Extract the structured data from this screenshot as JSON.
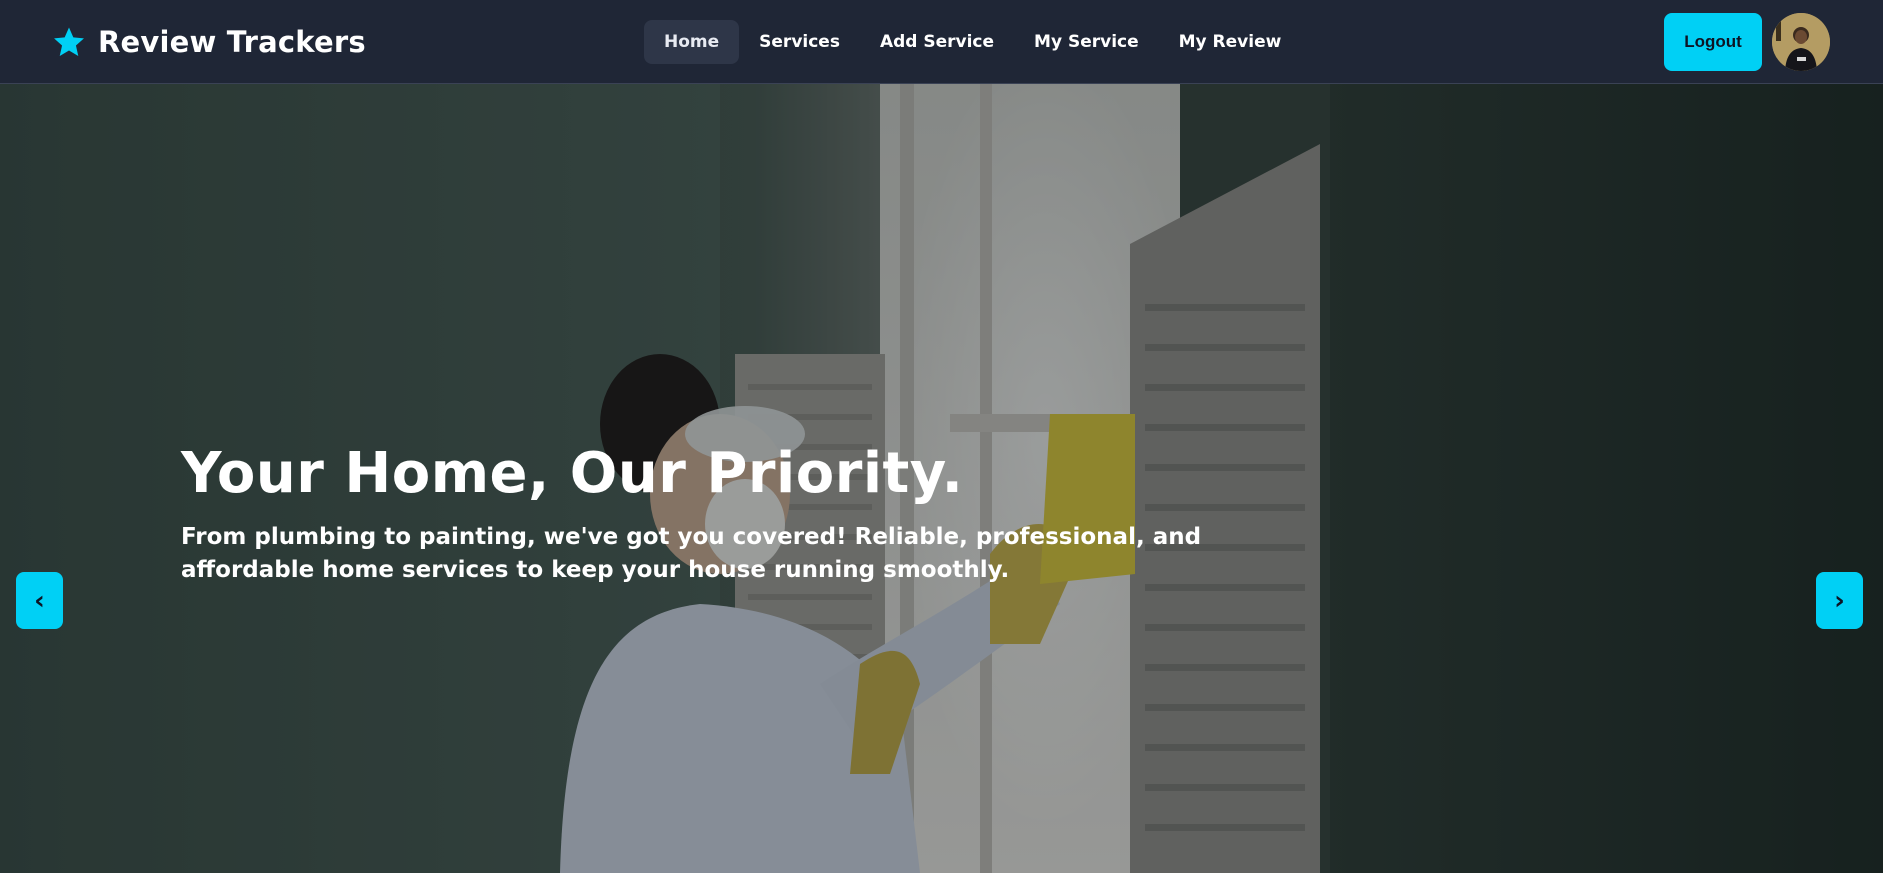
{
  "header": {
    "brand_name": "Review Trackers",
    "brand_icon": "star-icon",
    "accent_color": "#00d0f5",
    "nav_items": [
      {
        "label": "Home",
        "active": true
      },
      {
        "label": "Services",
        "active": false
      },
      {
        "label": "Add Service",
        "active": false
      },
      {
        "label": "My Service",
        "active": false
      },
      {
        "label": "My Review",
        "active": false
      }
    ],
    "logout_label": "Logout",
    "avatar_icon": "user-avatar"
  },
  "hero": {
    "headline": "Your Home, Our Priority.",
    "subtext": "From plumbing to painting, we've got you covered! Reliable, professional, and affordable home services to keep your house running smoothly.",
    "prev_label": "‹",
    "next_label": "›",
    "prev_icon": "chevron-left-icon",
    "next_icon": "chevron-right-icon"
  }
}
